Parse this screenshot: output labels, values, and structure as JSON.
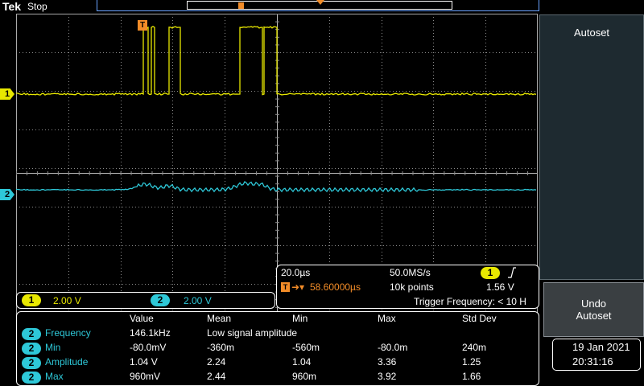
{
  "header": {
    "brand": "Tek",
    "acq_state": "Stop"
  },
  "colors": {
    "ch1": "#e8e800",
    "ch2": "#2ec8d8",
    "trigger": "#f28c28",
    "grid": "#8c8c8c"
  },
  "channels": {
    "ch1": {
      "label": "1",
      "scale": "2.00 V"
    },
    "ch2": {
      "label": "2",
      "scale": "2.00 V"
    }
  },
  "timebase": {
    "horizontal_scale": "20.0µs",
    "sample_rate": "50.0MS/s",
    "trigger_source": "1",
    "trigger_slope_icon": "rising-edge-icon",
    "trigger_position": "58.60000µs",
    "record_length": "10k points",
    "trigger_level": "1.56 V",
    "trigger_frequency": "Trigger Frequency: < 10 H"
  },
  "measurements": {
    "headers": [
      "Value",
      "Mean",
      "Min",
      "Max",
      "Std Dev"
    ],
    "rows": [
      {
        "ch": "2",
        "name": "Frequency",
        "value": "146.1kHz",
        "mean": "Low signal amplitude",
        "min": "",
        "max": "",
        "std": ""
      },
      {
        "ch": "2",
        "name": "Min",
        "value": "-80.0mV",
        "mean": "-360m",
        "min": "-560m",
        "max": "-80.0m",
        "std": "240m"
      },
      {
        "ch": "2",
        "name": "Amplitude",
        "value": "1.04 V",
        "mean": "2.24",
        "min": "1.04",
        "max": "3.36",
        "std": "1.25"
      },
      {
        "ch": "2",
        "name": "Max",
        "value": "960mV",
        "mean": "2.44",
        "min": "960m",
        "max": "3.92",
        "std": "1.66"
      }
    ]
  },
  "menu": {
    "autoset": "Autoset",
    "undo_line1": "Undo",
    "undo_line2": "Autoset"
  },
  "datetime": {
    "date": "19 Jan  2021",
    "time": "20:31:16"
  },
  "trigger_marker": "T"
}
